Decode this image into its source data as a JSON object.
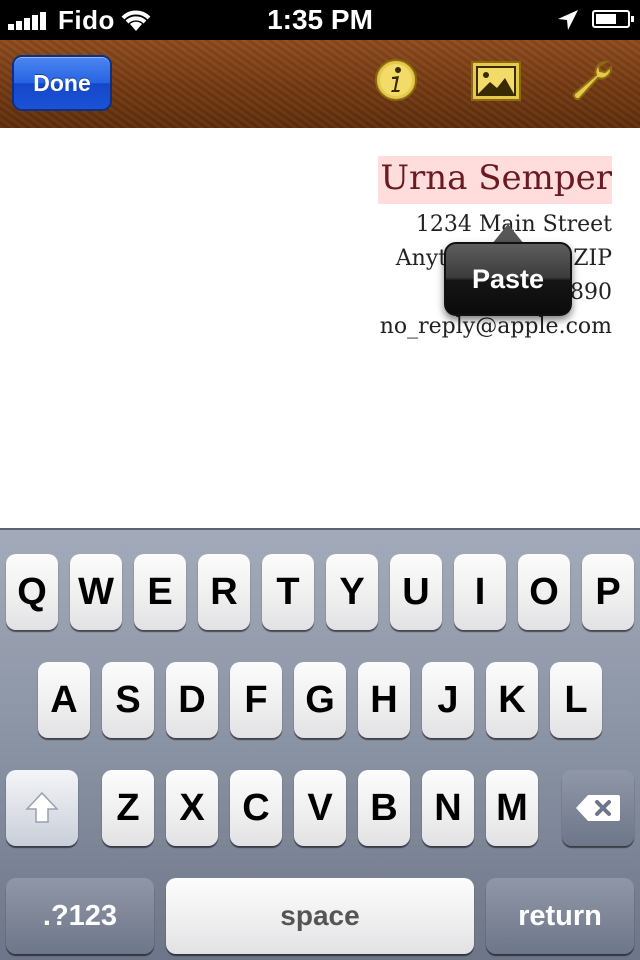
{
  "status_bar": {
    "carrier": "Fido",
    "time": "1:35 PM",
    "signal_icon": "signal-bars-icon",
    "wifi_icon": "wifi-icon",
    "location_icon": "location-arrow-icon",
    "battery_icon": "battery-icon"
  },
  "toolbar": {
    "done_label": "Done",
    "icons": [
      "info-icon",
      "photo-icon",
      "wrench-icon"
    ],
    "accent_color": "#2563e3"
  },
  "address": {
    "name": "Urna Semper",
    "street": "1234 Main Street",
    "city": "Anytown, State ZIP",
    "phone": "123-456-7890",
    "email": "no_reply@apple.com"
  },
  "popup": {
    "label": "Paste"
  },
  "keyboard": {
    "row1": [
      "Q",
      "W",
      "E",
      "R",
      "T",
      "Y",
      "U",
      "I",
      "O",
      "P"
    ],
    "row2": [
      "A",
      "S",
      "D",
      "F",
      "G",
      "H",
      "J",
      "K",
      "L"
    ],
    "row3": [
      "Z",
      "X",
      "C",
      "V",
      "B",
      "N",
      "M"
    ],
    "numbers_label": ".?123",
    "space_label": "space",
    "return_label": "return"
  }
}
